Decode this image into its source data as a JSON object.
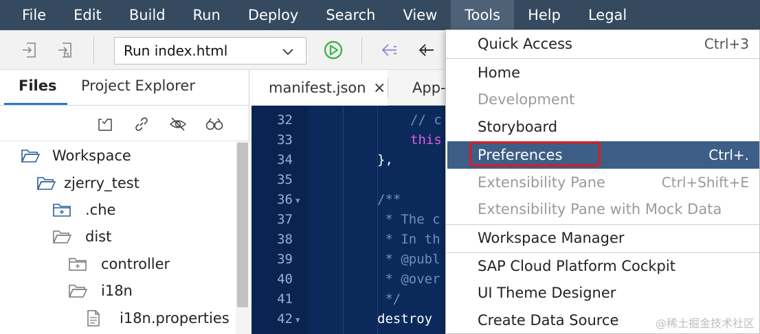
{
  "menubar": {
    "items": [
      "File",
      "Edit",
      "Build",
      "Run",
      "Deploy",
      "Search",
      "View",
      "Tools",
      "Help",
      "Legal"
    ],
    "active": "Tools"
  },
  "toolbar": {
    "run_config": "Run index.html",
    "icons": [
      "import-icon",
      "export-icon",
      "run-icon",
      "back-icon",
      "prev-icon"
    ]
  },
  "left_panel": {
    "tabs": [
      "Files",
      "Project Explorer"
    ],
    "active_tab": "Files",
    "tools": [
      "collapse-icon",
      "link-icon",
      "hidden-files-icon",
      "search-icon"
    ],
    "tree": [
      {
        "label": "Workspace",
        "icon": "folder-open-icon"
      },
      {
        "label": "zjerry_test",
        "icon": "folder-open-icon"
      },
      {
        "label": ".che",
        "icon": "folder-icon"
      },
      {
        "label": "dist",
        "icon": "folder-open-icon"
      },
      {
        "label": "controller",
        "icon": "folder-icon"
      },
      {
        "label": "i18n",
        "icon": "folder-open-icon"
      },
      {
        "label": "i18n.properties",
        "icon": "file-icon"
      }
    ]
  },
  "editor": {
    "tabs": [
      {
        "label": "manifest.json",
        "close": "×"
      },
      {
        "label": "App-"
      }
    ],
    "lines": [
      {
        "num": "32",
        "text": "// c"
      },
      {
        "num": "33",
        "text": "this"
      },
      {
        "num": "34",
        "text": "},"
      },
      {
        "num": "35",
        "text": ""
      },
      {
        "num": "36",
        "text": "/**"
      },
      {
        "num": "37",
        "text": " * The c"
      },
      {
        "num": "38",
        "text": " * In th"
      },
      {
        "num": "39",
        "text": " * @publ"
      },
      {
        "num": "40",
        "text": " * @over"
      },
      {
        "num": "41",
        "text": " */"
      },
      {
        "num": "42",
        "text": "destroy"
      }
    ]
  },
  "dropdown": {
    "items": [
      {
        "label": "Quick Access",
        "shortcut": "Ctrl+3",
        "state": "normal"
      },
      {
        "label": "Home",
        "shortcut": "",
        "state": "normal"
      },
      {
        "label": "Development",
        "shortcut": "",
        "state": "disabled"
      },
      {
        "label": "Storyboard",
        "shortcut": "",
        "state": "normal"
      },
      {
        "label": "Preferences",
        "shortcut": "Ctrl+.",
        "state": "highlighted"
      },
      {
        "label": "Extensibility Pane",
        "shortcut": "Ctrl+Shift+E",
        "state": "disabled"
      },
      {
        "label": "Extensibility Pane with Mock Data",
        "shortcut": "",
        "state": "disabled"
      },
      {
        "label": "Workspace Manager",
        "shortcut": "",
        "state": "normal"
      },
      {
        "label": "SAP Cloud Platform Cockpit",
        "shortcut": "",
        "state": "normal"
      },
      {
        "label": "UI Theme Designer",
        "shortcut": "",
        "state": "normal"
      },
      {
        "label": "Create Data Source",
        "shortcut": "",
        "state": "normal"
      }
    ]
  },
  "watermark": "@稀土掘金技术社区",
  "colors": {
    "menubar_bg": "#354a5f",
    "highlight_bg": "#3d5e86",
    "editor_bg": "#0b2a5b",
    "annotation_red": "#e11a1a",
    "run_green": "#3cb44b"
  }
}
